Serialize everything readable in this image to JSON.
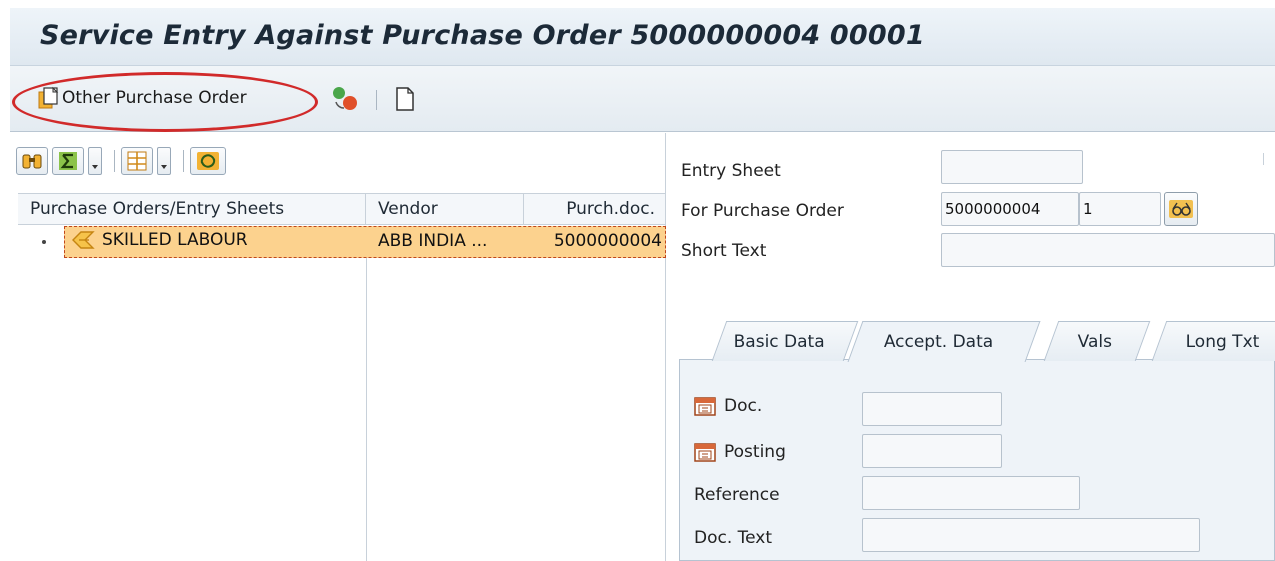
{
  "window": {
    "title": "Service Entry Against Purchase Order 5000000004 00001"
  },
  "toolbar": {
    "other_po_label": "Other Purchase Order"
  },
  "grid": {
    "columns": [
      "Purchase Orders/Entry Sheets",
      "Vendor",
      "Purch.doc."
    ],
    "rows": [
      {
        "text": "SKILLED LABOUR",
        "vendor": "ABB INDIA ...",
        "purch_doc": "5000000004"
      }
    ]
  },
  "header_fields": {
    "entry_sheet_label": "Entry Sheet",
    "entry_sheet_value": "",
    "for_po_label": "For Purchase Order",
    "po_number_value": "5000000004",
    "po_item_value": "1",
    "short_text_label": "Short Text",
    "short_text_value": ""
  },
  "tabs": [
    {
      "label": "Basic Data"
    },
    {
      "label": "Accept. Data"
    },
    {
      "label": "Vals"
    },
    {
      "label": "Long Txt"
    }
  ],
  "accept_data": {
    "doc_label": "Doc.",
    "posting_label": "Posting",
    "reference_label": "Reference",
    "doc_text_label": "Doc. Text"
  },
  "colors": {
    "selection": "#fcd28e",
    "highlight_ellipse": "#d12a2a"
  }
}
